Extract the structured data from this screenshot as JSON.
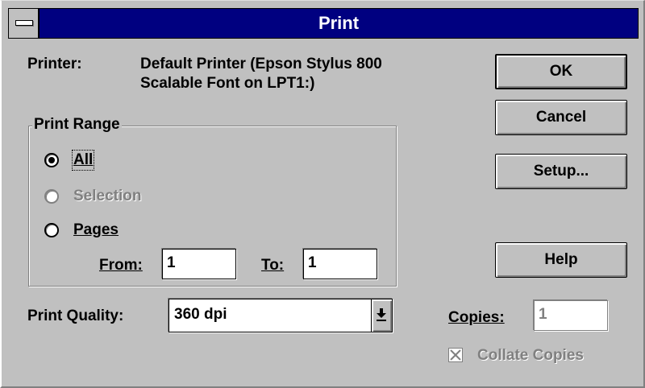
{
  "window": {
    "title": "Print"
  },
  "printer": {
    "label": "Printer:",
    "name_line1": "Default Printer (Epson Stylus 800",
    "name_line2": "Scalable Font on LPT1:)"
  },
  "print_range": {
    "legend": "Print Range",
    "options": [
      {
        "label": "All",
        "selected": true,
        "enabled": true
      },
      {
        "label": "Selection",
        "selected": false,
        "enabled": false
      },
      {
        "label": "Pages",
        "selected": false,
        "enabled": true
      }
    ],
    "from_label": "From:",
    "from_value": "1",
    "to_label": "To:",
    "to_value": "1"
  },
  "print_quality": {
    "label": "Print Quality:",
    "value": "360 dpi"
  },
  "copies": {
    "label": "Copies:",
    "value": "1",
    "enabled": false
  },
  "collate": {
    "label": "Collate Copies",
    "checked": true,
    "enabled": false
  },
  "buttons": {
    "ok": "OK",
    "cancel": "Cancel",
    "setup": "Setup...",
    "help": "Help"
  },
  "icons": {
    "system_menu": "system-menu-icon",
    "dropdown": "dropdown-arrow-icon",
    "check": "checkmark-icon"
  },
  "colors": {
    "titlebar": "#000080",
    "face": "#c0c0c0",
    "disabled_text": "#808080"
  }
}
